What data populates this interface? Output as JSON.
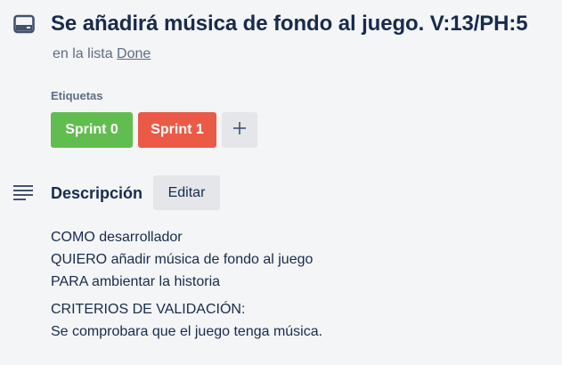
{
  "card": {
    "title": "Se añadirá música de fondo al juego.  V:13/PH:5",
    "in_list_prefix": "en la lista ",
    "list_name": "Done",
    "header_icon": "card-icon"
  },
  "labels": {
    "heading": "Etiquetas",
    "items": [
      {
        "name": "Sprint 0",
        "color": "#61bd4f"
      },
      {
        "name": "Sprint 1",
        "color": "#eb5a46"
      }
    ],
    "add_icon": "plus-icon"
  },
  "description": {
    "icon": "description-lines-icon",
    "heading": "Descripción",
    "edit_label": "Editar",
    "paragraphs": [
      {
        "lines": [
          "COMO desarrollador",
          "QUIERO añadir música de fondo al juego",
          "PARA ambientar la historia"
        ]
      },
      {
        "lines": [
          "CRITERIOS DE VALIDACIÓN:",
          "Se comprobara que el juego tenga música."
        ]
      }
    ]
  },
  "colors": {
    "background": "#f4f5f7",
    "text": "#172b4d",
    "muted": "#5e6c84",
    "button_bg": "#e4e6ea"
  }
}
